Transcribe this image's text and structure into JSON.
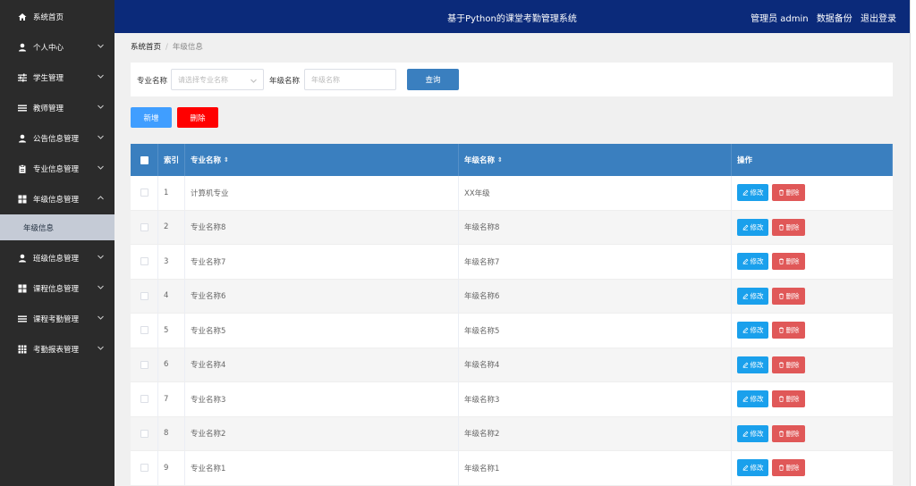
{
  "sidebar": {
    "items": [
      {
        "label": "系统首页",
        "icon": "home-icon",
        "chevron": false
      },
      {
        "label": "个人中心",
        "icon": "user-icon",
        "chevron": true
      },
      {
        "label": "学生管理",
        "icon": "sliders-icon",
        "chevron": true
      },
      {
        "label": "教师管理",
        "icon": "list-icon",
        "chevron": true
      },
      {
        "label": "公告信息管理",
        "icon": "user-icon",
        "chevron": true
      },
      {
        "label": "专业信息管理",
        "icon": "clipboard-icon",
        "chevron": true
      },
      {
        "label": "年级信息管理",
        "icon": "grid-icon",
        "chevron": true,
        "expanded": true
      },
      {
        "label": "班级信息管理",
        "icon": "user-icon",
        "chevron": true
      },
      {
        "label": "课程信息管理",
        "icon": "grid-icon",
        "chevron": true
      },
      {
        "label": "课程考勤管理",
        "icon": "list-icon",
        "chevron": true
      },
      {
        "label": "考勤报表管理",
        "icon": "table-icon",
        "chevron": true
      }
    ],
    "active_sub": "年级信息"
  },
  "header": {
    "title": "基于Python的课堂考勤管理系统",
    "admin": "管理员 admin",
    "backup": "数据备份",
    "logout": "退出登录"
  },
  "breadcrumb": {
    "home": "系统首页",
    "separator": "/",
    "current": "年级信息"
  },
  "search": {
    "major_label": "专业名称",
    "major_placeholder": "请选择专业名称",
    "grade_label": "年级名称",
    "grade_placeholder": "年级名称",
    "query_label": "查询"
  },
  "actions": {
    "add_label": "新增",
    "delete_label": "删除"
  },
  "table": {
    "headers": {
      "index": "索引",
      "major": "专业名称",
      "grade": "年级名称",
      "ops": "操作"
    },
    "rows": [
      {
        "index": "1",
        "major": "计算机专业",
        "grade": "XX年级"
      },
      {
        "index": "2",
        "major": "专业名称8",
        "grade": "年级名称8"
      },
      {
        "index": "3",
        "major": "专业名称7",
        "grade": "年级名称7"
      },
      {
        "index": "4",
        "major": "专业名称6",
        "grade": "年级名称6"
      },
      {
        "index": "5",
        "major": "专业名称5",
        "grade": "年级名称5"
      },
      {
        "index": "6",
        "major": "专业名称4",
        "grade": "年级名称4"
      },
      {
        "index": "7",
        "major": "专业名称3",
        "grade": "年级名称3"
      },
      {
        "index": "8",
        "major": "专业名称2",
        "grade": "年级名称2"
      },
      {
        "index": "9",
        "major": "专业名称1",
        "grade": "年级名称1"
      }
    ],
    "edit_label": "修改",
    "delete_label": "删除"
  },
  "colors": {
    "header_bg": "#0b2a7a",
    "sidebar_bg": "#2b2b2b",
    "table_head": "#3a7fbf",
    "primary": "#409eff",
    "danger": "#ff0000"
  }
}
